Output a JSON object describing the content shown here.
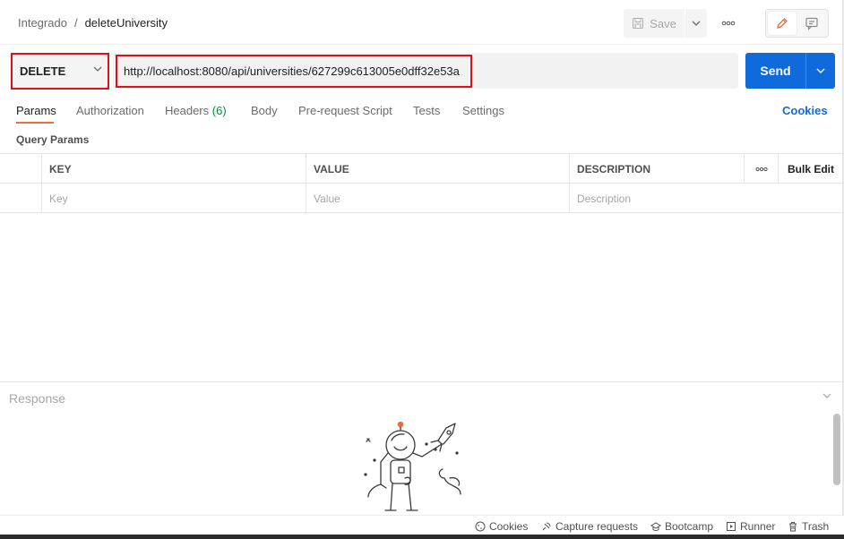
{
  "breadcrumb": {
    "parent": "Integrado",
    "separator": "/",
    "current": "deleteUniversity"
  },
  "toolbar": {
    "save_label": "Save"
  },
  "request": {
    "method": "DELETE",
    "url": "http://localhost:8080/api/universities/627299c613005e0dff32e53a",
    "send_label": "Send"
  },
  "tabs": [
    {
      "label": "Params"
    },
    {
      "label": "Authorization"
    },
    {
      "label": "Headers",
      "count": "(6)"
    },
    {
      "label": "Body"
    },
    {
      "label": "Pre-request Script"
    },
    {
      "label": "Tests"
    },
    {
      "label": "Settings"
    }
  ],
  "cookies_link": "Cookies",
  "query_params": {
    "title": "Query Params",
    "headers": {
      "key": "KEY",
      "value": "VALUE",
      "description": "DESCRIPTION",
      "bulk_edit": "Bulk Edit"
    },
    "placeholders": {
      "key": "Key",
      "value": "Value",
      "description": "Description"
    }
  },
  "response": {
    "title": "Response"
  },
  "statusbar": {
    "cookies": "Cookies",
    "capture": "Capture requests",
    "bootcamp": "Bootcamp",
    "runner": "Runner",
    "trash": "Trash"
  },
  "colors": {
    "accent": "#0f6bdc",
    "highlight": "#e0101a",
    "tab_active": "#f26b3a",
    "count": "#0b8a3e"
  }
}
